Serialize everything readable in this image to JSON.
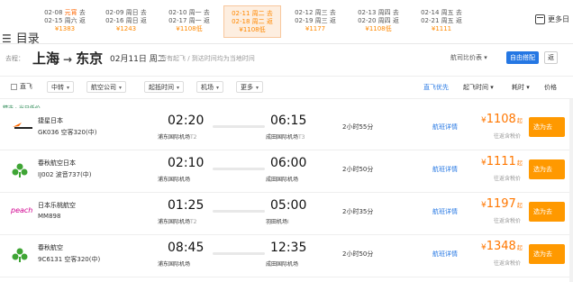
{
  "date_bar": {
    "dates": [
      {
        "line1": "02-08",
        "label1": "元宵",
        "suffix1": "去",
        "line2": "02-15",
        "label2": "周六",
        "suffix2": "返",
        "price": "¥1383",
        "holiday": true,
        "active": false
      },
      {
        "line1": "02-09",
        "label1": "周日",
        "suffix1": "去",
        "line2": "02-16",
        "label2": "周日",
        "suffix2": "返",
        "price": "¥1243",
        "holiday": false,
        "active": false
      },
      {
        "line1": "02-10",
        "label1": "周一",
        "suffix1": "去",
        "line2": "02-17",
        "label2": "周一",
        "suffix2": "返",
        "price": "¥1108低",
        "holiday": false,
        "active": false
      },
      {
        "line1": "02-11",
        "label1": "周二",
        "suffix1": "去",
        "line2": "02-18",
        "label2": "周二",
        "suffix2": "返",
        "price": "¥1108低",
        "holiday": false,
        "active": true
      },
      {
        "line1": "02-12",
        "label1": "周三",
        "suffix1": "去",
        "line2": "02-19",
        "label2": "周三",
        "suffix2": "返",
        "price": "¥1177",
        "holiday": false,
        "active": false
      },
      {
        "line1": "02-13",
        "label1": "周四",
        "suffix1": "去",
        "line2": "02-20",
        "label2": "周四",
        "suffix2": "返",
        "price": "¥1108低",
        "holiday": false,
        "active": false
      },
      {
        "line1": "02-14",
        "label1": "周五",
        "suffix1": "去",
        "line2": "02-21",
        "label2": "周五",
        "suffix2": "返",
        "price": "¥1111",
        "holiday": false,
        "active": false
      }
    ],
    "more_dates_label": "更多日"
  },
  "catalog": {
    "icon": "☰",
    "label": "目录"
  },
  "route": {
    "go_label": "去程：",
    "from": "上海",
    "arrow": "→",
    "to": "东京",
    "date": "02月11日 周二",
    "note": "所有起飞 / 到达时间均为当地时间",
    "compare_label": "航司比价表",
    "custom_button": "自由搭配",
    "other_button": "返"
  },
  "filters": {
    "direct": "直飞",
    "transfer": "中转",
    "airline": "航空公司",
    "time": "起抵时间",
    "airport": "机场",
    "more": "更多"
  },
  "sorts": {
    "direct_first": "直飞优先",
    "dep_time": "起飞时间",
    "duration": "耗时",
    "price": "价格"
  },
  "recommend_label": "精选 · 当日低价",
  "flights": [
    {
      "airline": "捷星日本",
      "flight": "GK036 空客320(中)",
      "dep_time": "02:20",
      "dep_airport": "浦东国际机场",
      "dep_terminal": "T2",
      "arr_time": "06:15",
      "arr_airport": "成田国际机场",
      "arr_terminal": "T3",
      "duration": "2小时55分",
      "detail": "航班详情",
      "price": "1108",
      "price_suffix": "起",
      "tax": "往返含税价",
      "book": "选为去",
      "logo": "jetstar"
    },
    {
      "airline": "春秋航空日本",
      "flight": "IJ002 波音737(中)",
      "dep_time": "02:10",
      "dep_airport": "浦东国际机场",
      "dep_terminal": "",
      "arr_time": "06:00",
      "arr_airport": "成田国际机场",
      "arr_terminal": "",
      "duration": "2小时50分",
      "detail": "航班详情",
      "price": "1111",
      "price_suffix": "起",
      "tax": "往返含税价",
      "book": "选为去",
      "logo": "spring"
    },
    {
      "airline": "日本乐桃航空",
      "flight": "MM898",
      "dep_time": "01:25",
      "dep_airport": "浦东国际机场",
      "dep_terminal": "T2",
      "arr_time": "05:00",
      "arr_airport": "羽田机场",
      "arr_terminal": "I",
      "duration": "2小时35分",
      "detail": "航班详情",
      "price": "1197",
      "price_suffix": "起",
      "tax": "往返含税价",
      "book": "选为去",
      "logo": "peach"
    },
    {
      "airline": "春秋航空",
      "flight": "9C6131 空客320(中)",
      "dep_time": "08:45",
      "dep_airport": "浦东国际机场",
      "dep_terminal": "",
      "arr_time": "12:35",
      "arr_airport": "成田国际机场",
      "arr_terminal": "",
      "duration": "2小时50分",
      "detail": "航班详情",
      "price": "1348",
      "price_suffix": "起",
      "tax": "往返含税价",
      "book": "选为去",
      "logo": "spring"
    }
  ],
  "colors": {
    "accent": "#2577e3",
    "price": "#ff7700",
    "book": "#ff9900",
    "active_date_bg": "#fdeee0"
  }
}
